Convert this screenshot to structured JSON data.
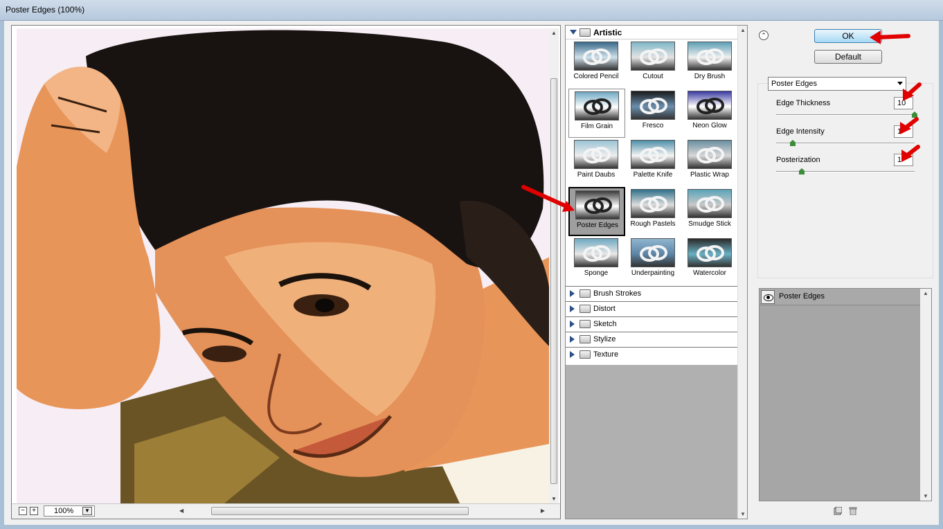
{
  "window": {
    "title": "Poster Edges (100%)"
  },
  "preview": {
    "zoom": "100%",
    "zoom_out_glyph": "−",
    "zoom_in_glyph": "+"
  },
  "filters": {
    "open_category": "Artistic",
    "items": [
      {
        "label": "Colored Pencil",
        "icon": "colored-pencil-thumbnail"
      },
      {
        "label": "Cutout",
        "icon": "cutout-thumbnail"
      },
      {
        "label": "Dry Brush",
        "icon": "dry-brush-thumbnail"
      },
      {
        "label": "Film Grain",
        "icon": "film-grain-thumbnail"
      },
      {
        "label": "Fresco",
        "icon": "fresco-thumbnail"
      },
      {
        "label": "Neon Glow",
        "icon": "neon-glow-thumbnail"
      },
      {
        "label": "Paint Daubs",
        "icon": "paint-daubs-thumbnail"
      },
      {
        "label": "Palette Knife",
        "icon": "palette-knife-thumbnail"
      },
      {
        "label": "Plastic Wrap",
        "icon": "plastic-wrap-thumbnail"
      },
      {
        "label": "Poster Edges",
        "icon": "poster-edges-thumbnail",
        "selected": true
      },
      {
        "label": "Rough Pastels",
        "icon": "rough-pastels-thumbnail"
      },
      {
        "label": "Smudge Stick",
        "icon": "smudge-stick-thumbnail"
      },
      {
        "label": "Sponge",
        "icon": "sponge-thumbnail"
      },
      {
        "label": "Underpainting",
        "icon": "underpainting-thumbnail"
      },
      {
        "label": "Watercolor",
        "icon": "watercolor-thumbnail"
      }
    ],
    "categories": [
      "Brush Strokes",
      "Distort",
      "Sketch",
      "Stylize",
      "Texture"
    ]
  },
  "buttons": {
    "ok": "OK",
    "default": "Default"
  },
  "settings": {
    "filter_select": "Poster Edges",
    "params": [
      {
        "label": "Edge Thickness",
        "value": "10",
        "level": 1.0
      },
      {
        "label": "Edge Intensity",
        "value": "1",
        "level": 0.1
      },
      {
        "label": "Posterization",
        "value": "1",
        "level": 0.17
      }
    ]
  },
  "layers": {
    "items": [
      {
        "label": "Poster Edges",
        "visible": true
      }
    ]
  },
  "colors": {
    "annotation_arrow": "#e00000",
    "selected_filter_bg": "#9e9e9e",
    "ok_button_border": "#3c7fb1"
  }
}
